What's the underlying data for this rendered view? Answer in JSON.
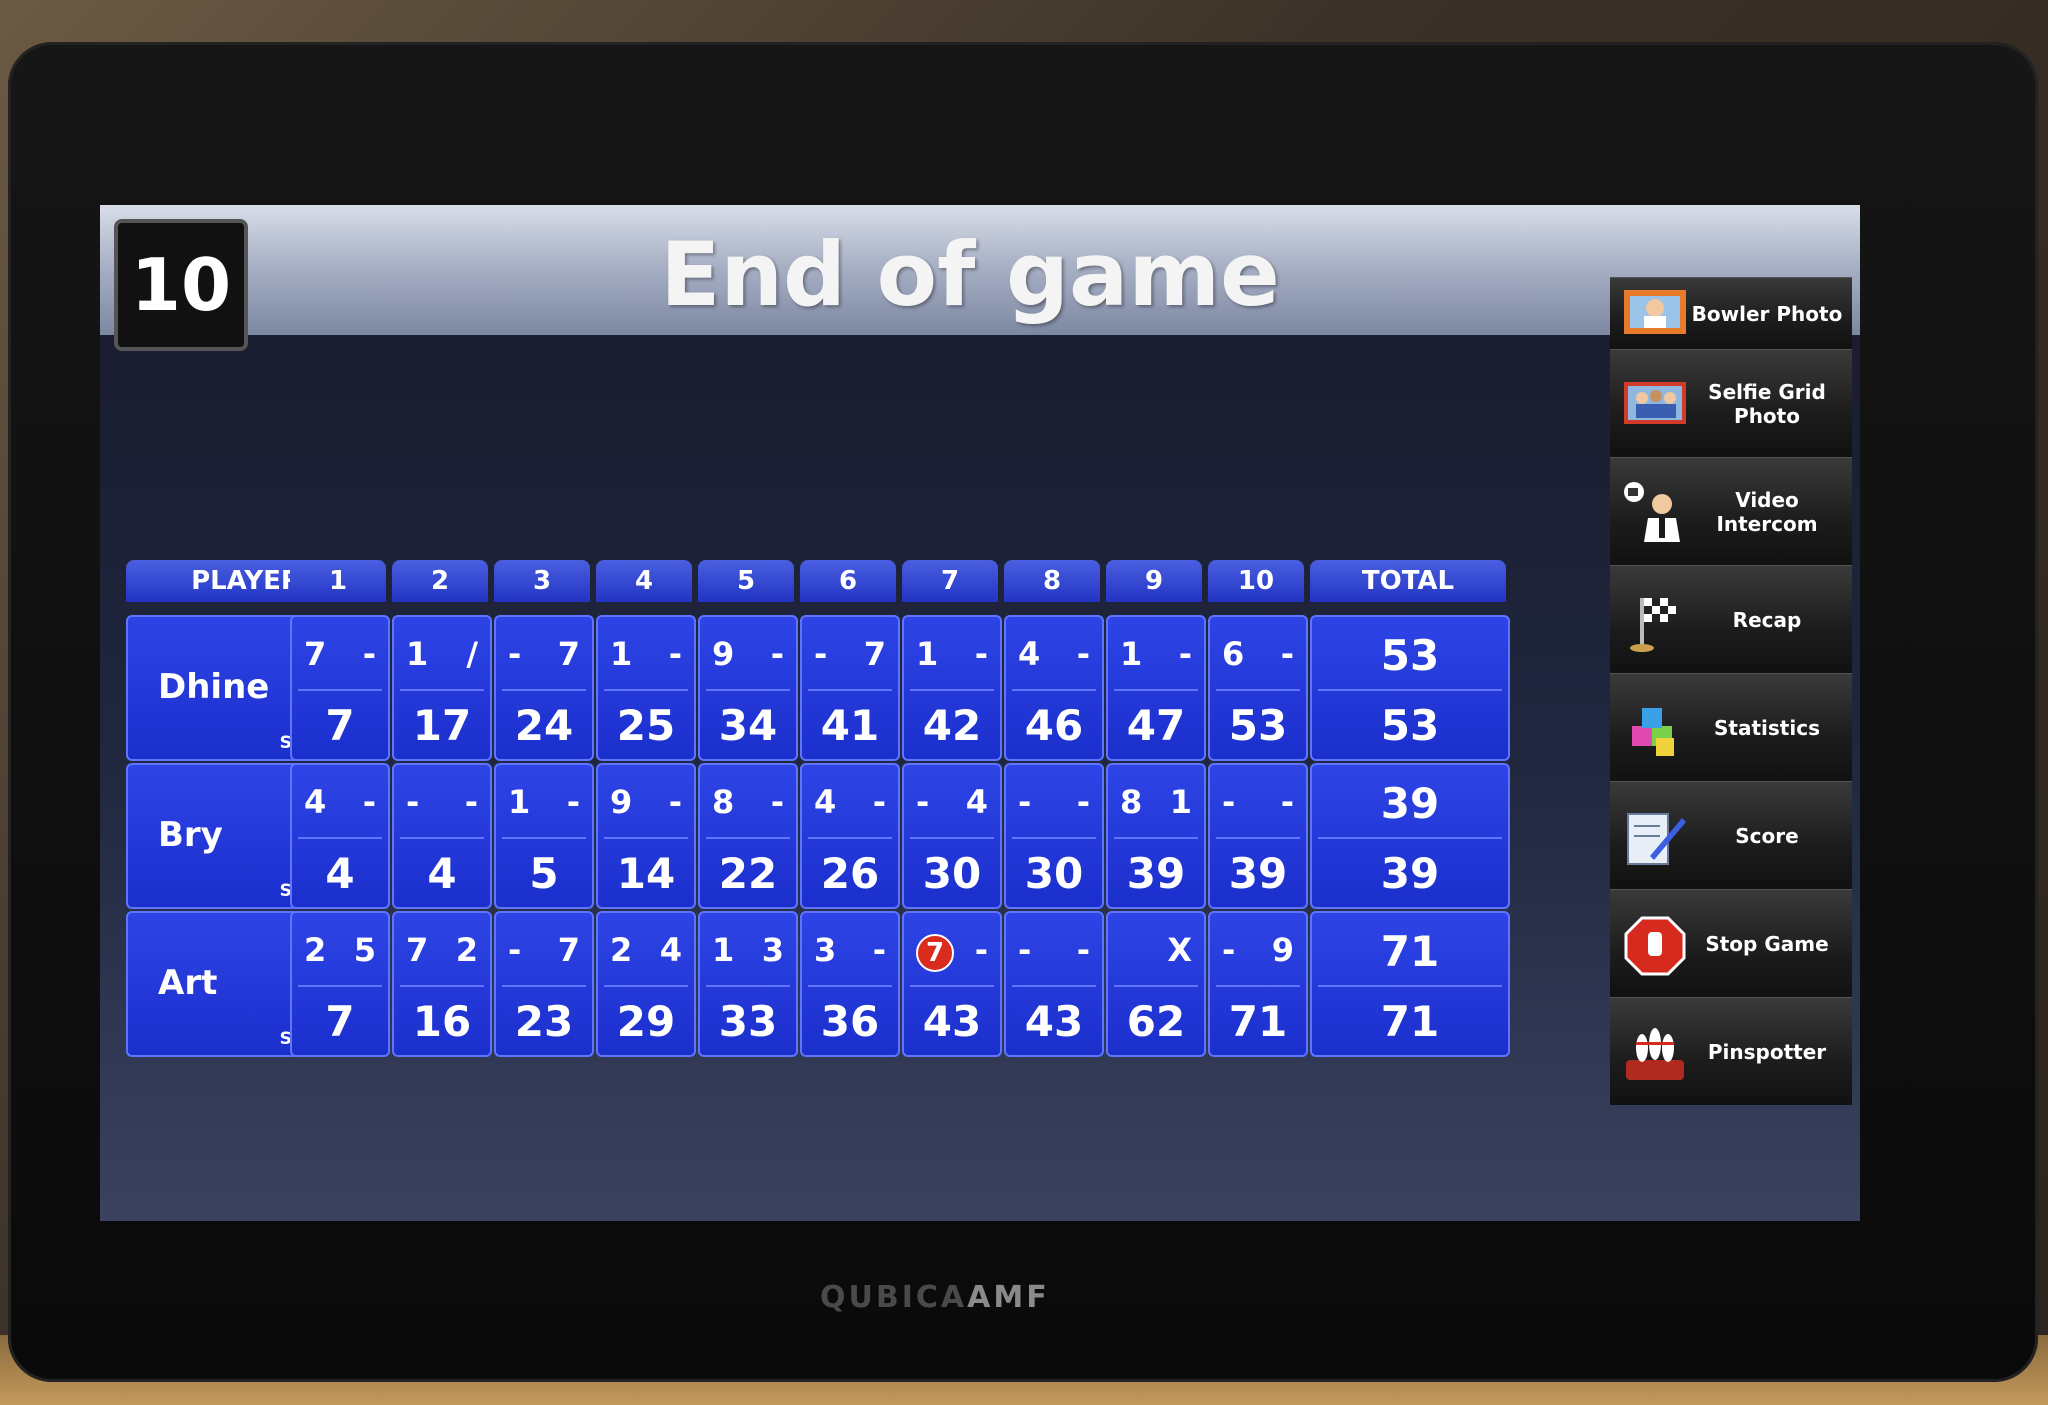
{
  "header": {
    "frame_number": "10",
    "title": "End of game"
  },
  "table": {
    "player_header": "PLAYER",
    "frame_headers": [
      "1",
      "2",
      "3",
      "4",
      "5",
      "6",
      "7",
      "8",
      "9",
      "10"
    ],
    "total_header": "TOTAL",
    "players": [
      {
        "name": "Dhine",
        "status": "SKIPPED",
        "frames": [
          {
            "b1": "7",
            "b2": "-",
            "cum": "7"
          },
          {
            "b1": "1",
            "b2": "/",
            "cum": "17"
          },
          {
            "b1": "-",
            "b2": "7",
            "cum": "24"
          },
          {
            "b1": "1",
            "b2": "-",
            "cum": "25"
          },
          {
            "b1": "9",
            "b2": "-",
            "cum": "34"
          },
          {
            "b1": "-",
            "b2": "7",
            "cum": "41"
          },
          {
            "b1": "1",
            "b2": "-",
            "cum": "42"
          },
          {
            "b1": "4",
            "b2": "-",
            "cum": "46"
          },
          {
            "b1": "1",
            "b2": "-",
            "cum": "47"
          },
          {
            "b1": "6",
            "b2": "-",
            "cum": "53"
          }
        ],
        "total_top": "53",
        "total_bottom": "53"
      },
      {
        "name": "Bry",
        "status": "SKIPPED",
        "frames": [
          {
            "b1": "4",
            "b2": "-",
            "cum": "4"
          },
          {
            "b1": "-",
            "b2": "-",
            "cum": "4"
          },
          {
            "b1": "1",
            "b2": "-",
            "cum": "5"
          },
          {
            "b1": "9",
            "b2": "-",
            "cum": "14"
          },
          {
            "b1": "8",
            "b2": "-",
            "cum": "22"
          },
          {
            "b1": "4",
            "b2": "-",
            "cum": "26"
          },
          {
            "b1": "-",
            "b2": "4",
            "cum": "30"
          },
          {
            "b1": "-",
            "b2": "-",
            "cum": "30"
          },
          {
            "b1": "8",
            "b2": "1",
            "cum": "39"
          },
          {
            "b1": "-",
            "b2": "-",
            "cum": "39"
          }
        ],
        "total_top": "39",
        "total_bottom": "39"
      },
      {
        "name": "Art",
        "status": "SKIPPED",
        "frames": [
          {
            "b1": "2",
            "b2": "5",
            "cum": "7"
          },
          {
            "b1": "7",
            "b2": "2",
            "cum": "16"
          },
          {
            "b1": "-",
            "b2": "7",
            "cum": "23"
          },
          {
            "b1": "2",
            "b2": "4",
            "cum": "29"
          },
          {
            "b1": "1",
            "b2": "3",
            "cum": "33"
          },
          {
            "b1": "3",
            "b2": "-",
            "cum": "36"
          },
          {
            "b1": "7",
            "b2": "-",
            "cum": "43",
            "split": true
          },
          {
            "b1": "-",
            "b2": "-",
            "cum": "43"
          },
          {
            "b1": "",
            "b2": "X",
            "cum": "62"
          },
          {
            "b1": "-",
            "b2": "9",
            "cum": "71"
          }
        ],
        "total_top": "71",
        "total_bottom": "71"
      }
    ]
  },
  "side_menu": [
    {
      "label": "Bowler Photo",
      "icon": "bowler-photo-icon"
    },
    {
      "label": "Selfie Grid Photo",
      "icon": "selfie-grid-icon"
    },
    {
      "label": "Video Intercom",
      "icon": "video-intercom-icon"
    },
    {
      "label": "Recap",
      "icon": "checkered-flag-icon"
    },
    {
      "label": "Statistics",
      "icon": "statistics-cubes-icon"
    },
    {
      "label": "Score",
      "icon": "score-sheet-icon"
    },
    {
      "label": "Stop Game",
      "icon": "stop-sign-icon"
    },
    {
      "label": "Pinspotter",
      "icon": "pinspotter-icon"
    }
  ],
  "brand": {
    "left": "QUBICA",
    "right": "AMF"
  },
  "colors": {
    "cell_blue": "#1a2fcc",
    "cell_border": "#5f74ff",
    "split_red": "#d92b1e"
  }
}
